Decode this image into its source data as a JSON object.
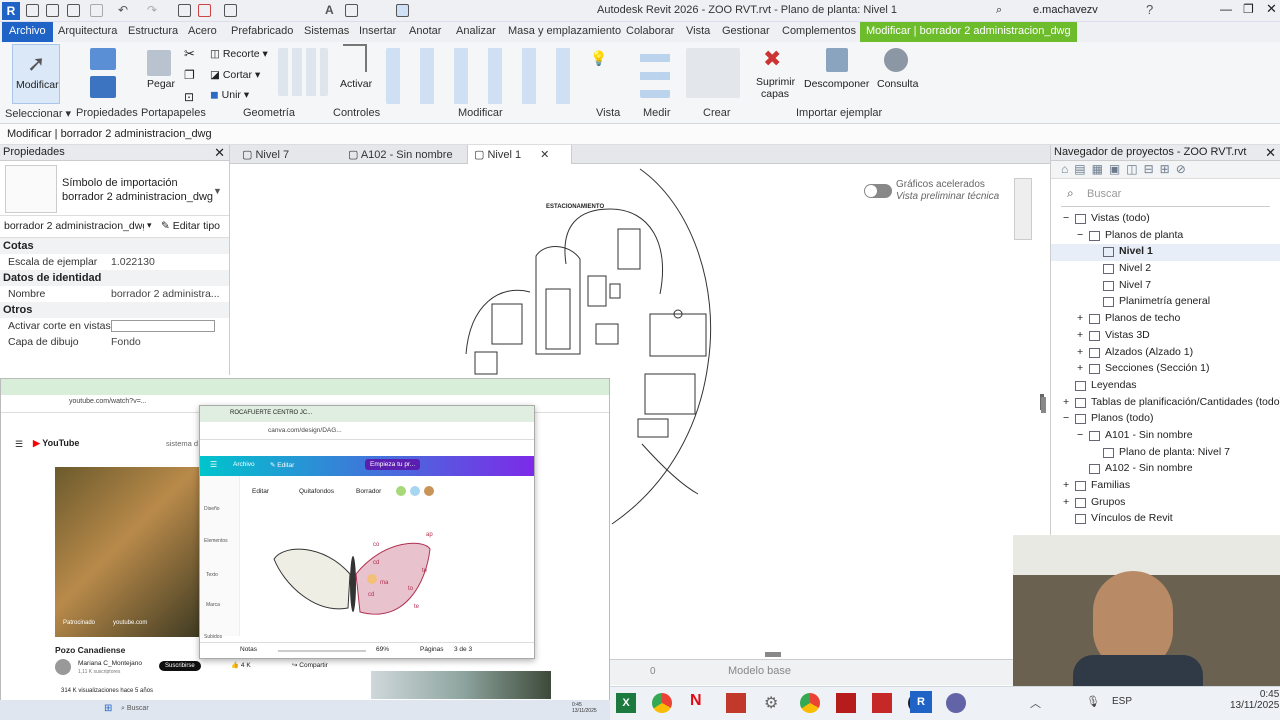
{
  "app": {
    "title": "Autodesk Revit 2026 - ZOO RVT.rvt - Plano de planta: Nivel 1",
    "user": "e.machavezv",
    "logo": "R"
  },
  "menu": [
    "Archivo",
    "Arquitectura",
    "Estructura",
    "Acero",
    "Prefabricado",
    "Sistemas",
    "Insertar",
    "Anotar",
    "Analizar",
    "Masa y emplazamiento",
    "Colaborar",
    "Vista",
    "Gestionar",
    "Complementos"
  ],
  "menu_context": "Modificar | borrador 2 administracion_dwg",
  "ribbon": {
    "modificar": "Modificar",
    "pegar": "Pegar",
    "recorte": "Recorte",
    "cortar": "Cortar",
    "unir": "Unir",
    "activar": "Activar",
    "suprimir": "Suprimir capas",
    "descomponer": "Descomponer",
    "consulta": "Consulta",
    "groups": [
      "Seleccionar",
      "Propiedades",
      "Portapapeles",
      "Geometría",
      "Controles",
      "Modificar",
      "Vista",
      "Medir",
      "Crear",
      "Importar ejemplar"
    ]
  },
  "status": "Modificar | borrador 2 administracion_dwg",
  "properties": {
    "title": "Propiedades",
    "type_name": "Símbolo de importación",
    "type_sub": "borrador 2 administracion_dwg",
    "selector": "borrador 2 administracion_dwg",
    "edit_type": "Editar tipo",
    "sections": [
      {
        "name": "Cotas",
        "rows": [
          {
            "k": "Escala de ejemplar",
            "v": "1.022130"
          }
        ]
      },
      {
        "name": "Datos de identidad",
        "rows": [
          {
            "k": "Nombre",
            "v": "borrador 2 administra..."
          }
        ]
      },
      {
        "name": "Otros",
        "rows": [
          {
            "k": "Activar corte en vistas",
            "v": ""
          },
          {
            "k": "Capa de dibujo",
            "v": "Fondo"
          }
        ]
      }
    ]
  },
  "tabs": [
    "Nivel 7",
    "A102 - Sin nombre",
    "Nivel 1"
  ],
  "canvas": {
    "label": "ESTACIONAMIENTO",
    "toggle1": "Gráficos acelerados",
    "toggle2": "Vista preliminar técnica"
  },
  "navigator": {
    "title": "Navegador de proyectos - ZOO RVT.rvt",
    "search": "Buscar",
    "items": [
      {
        "t": "Vistas (todo)",
        "lvl": 0,
        "exp": "−"
      },
      {
        "t": "Planos de planta",
        "lvl": 1,
        "exp": "−"
      },
      {
        "t": "Nivel 1",
        "lvl": 2,
        "exp": "",
        "bold": true
      },
      {
        "t": "Nivel 2",
        "lvl": 2,
        "exp": ""
      },
      {
        "t": "Nivel 7",
        "lvl": 2,
        "exp": ""
      },
      {
        "t": "Planimetría general",
        "lvl": 2,
        "exp": ""
      },
      {
        "t": "Planos de techo",
        "lvl": 1,
        "exp": "+"
      },
      {
        "t": "Vistas 3D",
        "lvl": 1,
        "exp": "+"
      },
      {
        "t": "Alzados (Alzado 1)",
        "lvl": 1,
        "exp": "+"
      },
      {
        "t": "Secciones (Sección 1)",
        "lvl": 1,
        "exp": "+"
      },
      {
        "t": "Leyendas",
        "lvl": 0,
        "exp": ""
      },
      {
        "t": "Tablas de planificación/Cantidades (todo)",
        "lvl": 0,
        "exp": "+"
      },
      {
        "t": "Planos (todo)",
        "lvl": 0,
        "exp": "−"
      },
      {
        "t": "A101 - Sin nombre",
        "lvl": 1,
        "exp": "−"
      },
      {
        "t": "Plano de planta: Nivel 7",
        "lvl": 2,
        "exp": ""
      },
      {
        "t": "A102 - Sin nombre",
        "lvl": 1,
        "exp": ""
      },
      {
        "t": "Familias",
        "lvl": 0,
        "exp": "+"
      },
      {
        "t": "Grupos",
        "lvl": 0,
        "exp": "+"
      },
      {
        "t": "Vínculos de Revit",
        "lvl": 0,
        "exp": ""
      }
    ]
  },
  "browser1": {
    "url": "youtube.com/watch?v=...",
    "yt": "YouTube",
    "video_title": "Pozo Canadiense",
    "channel": "Mariana C_Montejano",
    "subscribers": "1,11 K suscriptores",
    "subscribe": "Suscribirse",
    "likes": "4 K",
    "share": "Compartir",
    "views": "314 K visualizaciones  hace 5 años",
    "sponsored": "Patrocinado",
    "sponsor_url": "youtube.com",
    "search_hint": "sistema d"
  },
  "browser2": {
    "tab": "ROCAFUERTE CENTRO JC...",
    "url": "canva.com/design/DAG...",
    "menu_archivo": "Archivo",
    "menu_editar": "Editar",
    "menu_plan": "Empieza tu pr...",
    "tool_editar": "Editar",
    "tool_quitafondos": "Quitafondos",
    "tool_borrador": "Borrador",
    "side": [
      "Diseño",
      "Elementos",
      "Texto",
      "Marca",
      "Subidos"
    ],
    "notes": "Notas",
    "zoom": "69%",
    "pages": "Páginas",
    "page_count": "3 de 3",
    "labels": [
      "ap",
      "co",
      "cd",
      "ma",
      "te",
      "cd",
      "to",
      "te"
    ]
  },
  "revit_bottom": {
    "model": "Modelo base",
    "zero": "0"
  },
  "taskbar": {
    "search": "Buscar",
    "lang": "ESP",
    "time": "0:45",
    "date": "13/11/2025",
    "small_time": "0:45",
    "small_date": "13/11/2025"
  },
  "colors": {
    "accent": "#1f63c6",
    "context": "#6dbc2c",
    "canva": "#7d2ae8"
  }
}
